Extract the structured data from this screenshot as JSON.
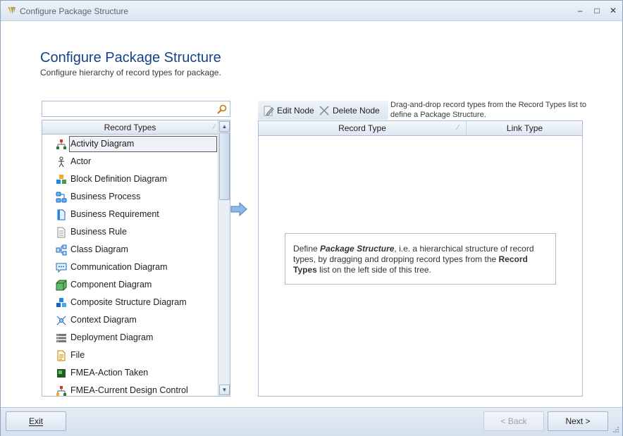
{
  "window": {
    "title": "Configure Package Structure",
    "minimize_glyph": "–",
    "maximize_glyph": "□",
    "close_glyph": "✕"
  },
  "header": {
    "title": "Configure Package Structure",
    "subtitle": "Configure hierarchy of record types for package."
  },
  "search": {
    "value": "",
    "placeholder": ""
  },
  "record_types": {
    "column_header": "Record Types",
    "sort_glyph": "⁄",
    "items": [
      {
        "label": "Activity Diagram",
        "icon": "activity-diagram-icon",
        "selected": true
      },
      {
        "label": "Actor",
        "icon": "actor-icon"
      },
      {
        "label": "Block Definition Diagram",
        "icon": "block-definition-diagram-icon"
      },
      {
        "label": "Business Process",
        "icon": "business-process-icon"
      },
      {
        "label": "Business Requirement",
        "icon": "business-requirement-icon"
      },
      {
        "label": "Business Rule",
        "icon": "business-rule-icon"
      },
      {
        "label": "Class Diagram",
        "icon": "class-diagram-icon"
      },
      {
        "label": "Communication Diagram",
        "icon": "communication-diagram-icon"
      },
      {
        "label": "Component Diagram",
        "icon": "component-diagram-icon"
      },
      {
        "label": "Composite Structure Diagram",
        "icon": "composite-structure-diagram-icon"
      },
      {
        "label": "Context Diagram",
        "icon": "context-diagram-icon"
      },
      {
        "label": "Deployment Diagram",
        "icon": "deployment-diagram-icon"
      },
      {
        "label": "File",
        "icon": "file-icon"
      },
      {
        "label": "FMEA-Action Taken",
        "icon": "fmea-action-taken-icon"
      },
      {
        "label": "FMEA-Current Design Control",
        "icon": "fmea-current-design-control-icon"
      }
    ]
  },
  "toolbar": {
    "edit_label": "Edit Node",
    "delete_label": "Delete Node"
  },
  "hint": "Drag-and-drop record types from the Record Types list to define a Package Structure.",
  "tree": {
    "col_record_type": "Record Type",
    "col_link_type": "Link Type",
    "sort_glyph": "⁄"
  },
  "info": {
    "part1": "Define ",
    "part2": "Package Structure",
    "part3": ", i.e. a hierarchical structure of record types, by dragging and dropping record types from the ",
    "part4": "Record Types",
    "part5": " list on the left side of this tree."
  },
  "footer": {
    "exit_label": "Exit",
    "back_label": "< Back",
    "next_label": "Next >"
  }
}
